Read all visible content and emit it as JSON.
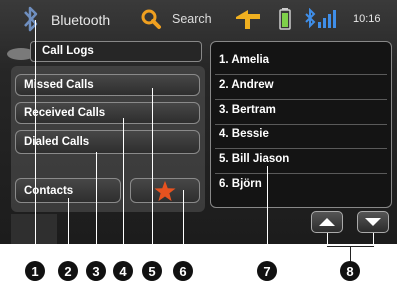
{
  "status_bar": {
    "title": "Bluetooth",
    "search_label": "Search",
    "time": "10:16",
    "icons": [
      "bluetooth-icon",
      "search-icon",
      "navigation-icon",
      "battery-icon",
      "bluetooth-signal-icon"
    ]
  },
  "call_logs_title": "Call Logs",
  "menu": {
    "missed": "Missed Calls",
    "received": "Received Calls",
    "dialed": "Dialed Calls",
    "contacts": "Contacts"
  },
  "contacts": [
    "1. Amelia",
    "2. Andrew",
    "3. Bertram",
    "4. Bessie",
    "5. Bill Jiason",
    "6. Björn"
  ],
  "callouts": [
    "1",
    "2",
    "3",
    "4",
    "5",
    "6",
    "7",
    "8"
  ],
  "colors": {
    "favorite_star": "#e8521f",
    "accent_blue": "#2f7be0"
  }
}
